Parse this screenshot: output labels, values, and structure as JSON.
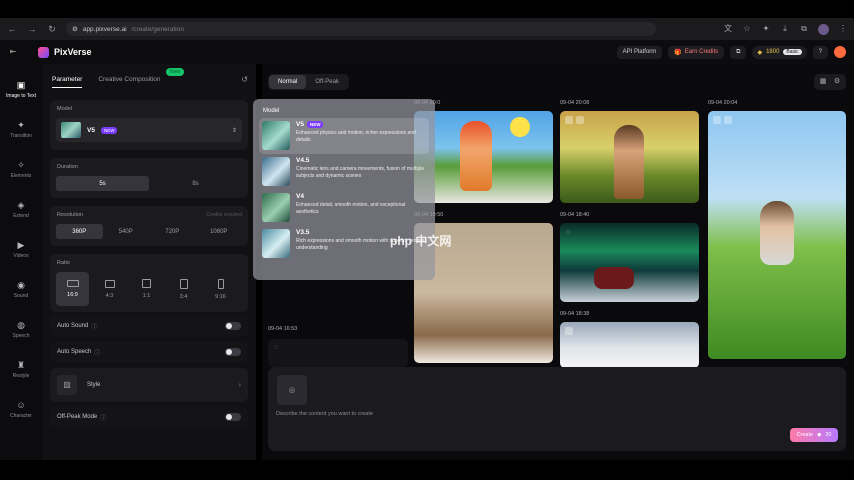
{
  "browser": {
    "url_host": "app.pixverse.ai",
    "url_path": "/create/generation",
    "icons": [
      "back-icon",
      "forward-icon",
      "reload-icon",
      "site-info-icon",
      "translate-icon",
      "star-icon",
      "extension-icon",
      "download-icon",
      "puzzle-icon",
      "profile-icon",
      "menu-icon"
    ]
  },
  "header": {
    "brand": "PixVerse",
    "api_label": "API Platform",
    "earn_label": "Earn Credits",
    "credits": "1800",
    "plan_badge": "Basic"
  },
  "rail": {
    "items": [
      {
        "label": "Image to Text",
        "icon": "image-icon"
      },
      {
        "label": "Transition",
        "icon": "sparkle-icon"
      },
      {
        "label": "Elements",
        "icon": "elements-icon"
      },
      {
        "label": "Extend",
        "icon": "cube-icon"
      },
      {
        "label": "Videos",
        "icon": "video-icon"
      },
      {
        "label": "Sound",
        "icon": "sound-icon"
      },
      {
        "label": "Speech",
        "icon": "speech-icon"
      },
      {
        "label": "Restyle",
        "icon": "restyle-icon"
      },
      {
        "label": "Character",
        "icon": "character-icon"
      }
    ]
  },
  "panel": {
    "tabs": [
      "Parameter",
      "Creative Composition"
    ],
    "new_pill": "New",
    "model": {
      "label": "Model",
      "name": "V5",
      "tag": "NEW"
    },
    "duration": {
      "label": "Duration",
      "options": [
        "5s",
        "8s"
      ],
      "selected": "5s"
    },
    "resolution": {
      "label": "Resolution",
      "hint": "Credits required",
      "options": [
        "360P",
        "540P",
        "720P",
        "1080P"
      ],
      "selected": "360P"
    },
    "ratio": {
      "label": "Ratio",
      "options": [
        "16:9",
        "4:3",
        "1:1",
        "3:4",
        "9:16"
      ],
      "selected": "16:9"
    },
    "toggles": [
      {
        "label": "Auto Sound",
        "on": false
      },
      {
        "label": "Auto Speech",
        "on": false
      },
      {
        "label": "Off-Peak Mode",
        "on": false
      }
    ],
    "style_label": "Style"
  },
  "dropdown": {
    "title": "Model",
    "items": [
      {
        "name": "V5",
        "tag": "NEW",
        "desc": "Enhanced physics and motion, richer expressions and details"
      },
      {
        "name": "V4.5",
        "tag": "",
        "desc": "Cinematic lens and camera movements, fusion of multiple subjects and dynamic scenes"
      },
      {
        "name": "V4",
        "tag": "",
        "desc": "Enhanced detail, smooth motion, and exceptional aesthetics"
      },
      {
        "name": "V3.5",
        "tag": "",
        "desc": "Rich expressions and smooth motion with superior prompt understanding"
      }
    ]
  },
  "main": {
    "modes": [
      "Normal",
      "Off-Peak"
    ],
    "selected_mode": "Normal",
    "timestamps": [
      "09-04 20:0",
      "09-04 20:08",
      "09-04 20:04",
      "09-04 19:50",
      "09-04 18:40",
      "09-04 18:38",
      "09-04 16:53"
    ],
    "prompt_placeholder": "Describe the content you want to create",
    "create_label": "Create",
    "create_cost": "20"
  },
  "watermark": "php 中文网",
  "colors": {
    "accent": "#7a3cff",
    "new_badge": "#18c46b",
    "create_from": "#ff7aa8",
    "create_to": "#b57aff"
  }
}
